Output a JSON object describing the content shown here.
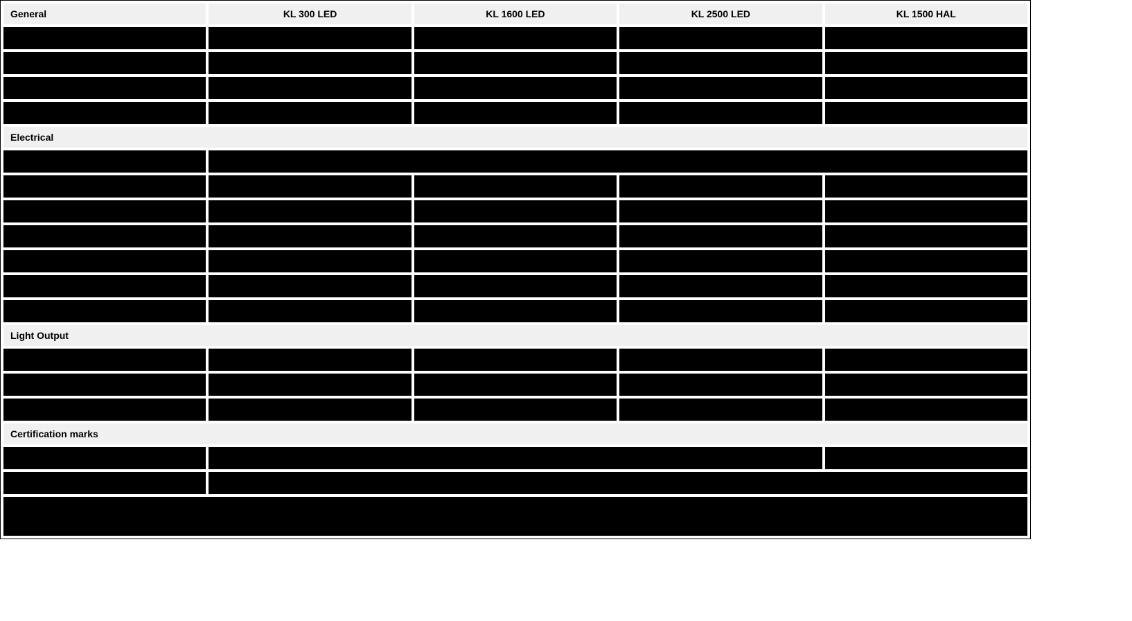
{
  "columns": {
    "label": "General",
    "products": [
      "KL 300 LED",
      "KL 1600 LED",
      "KL 2500 LED",
      "KL 1500 HAL"
    ]
  },
  "sections": [
    {
      "title": "General",
      "is_header": true,
      "rows": [
        {
          "cells": [
            "",
            "",
            "",
            "",
            ""
          ]
        },
        {
          "cells": [
            "",
            "",
            "",
            "",
            ""
          ]
        },
        {
          "cells": [
            "",
            "",
            "",
            "",
            ""
          ]
        },
        {
          "cells": [
            "",
            "",
            "",
            "",
            ""
          ]
        }
      ]
    },
    {
      "title": "Electrical",
      "rows": [
        {
          "cells": [
            "",
            {
              "colspan": 4,
              "value": ""
            }
          ]
        },
        {
          "cells": [
            "",
            "",
            "",
            "",
            ""
          ]
        },
        {
          "cells": [
            "",
            "",
            "",
            "",
            ""
          ]
        },
        {
          "cells": [
            "",
            "",
            "",
            "",
            ""
          ]
        },
        {
          "cells": [
            "",
            "",
            "",
            "",
            ""
          ]
        },
        {
          "cells": [
            "",
            "",
            "",
            "",
            ""
          ]
        },
        {
          "cells": [
            "",
            "",
            "",
            "",
            ""
          ]
        }
      ]
    },
    {
      "title": "Light Output",
      "rows": [
        {
          "cells": [
            "",
            "",
            "",
            "",
            ""
          ]
        },
        {
          "cells": [
            "",
            "",
            "",
            "",
            ""
          ]
        },
        {
          "cells": [
            "",
            "",
            "",
            "",
            ""
          ]
        }
      ]
    },
    {
      "title": "Certification marks",
      "rows": [
        {
          "cells": [
            "",
            {
              "colspan": 3,
              "value": ""
            },
            ""
          ]
        },
        {
          "cells": [
            "",
            {
              "colspan": 4,
              "value": ""
            }
          ]
        },
        {
          "tall": true,
          "cells": [
            {
              "colspan": 5,
              "value": ""
            }
          ]
        }
      ]
    }
  ]
}
